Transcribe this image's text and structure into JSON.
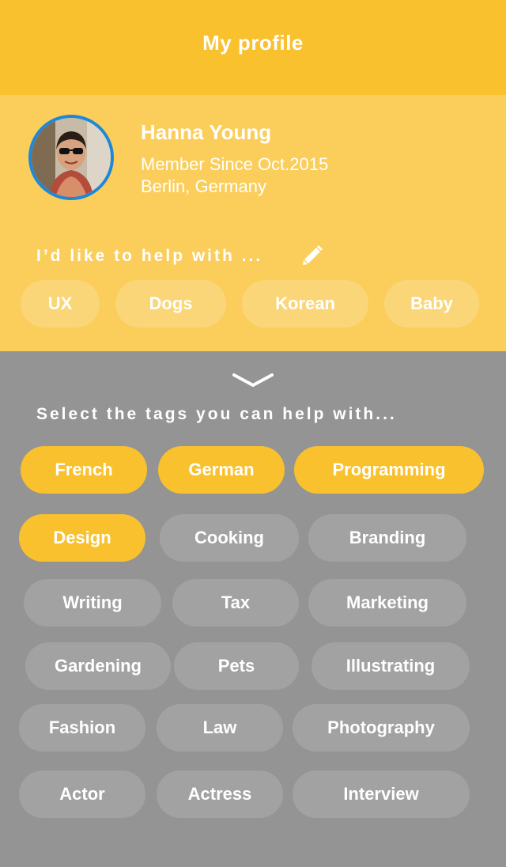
{
  "header": {
    "title": "My profile"
  },
  "profile": {
    "name": "Hanna Young",
    "member_since": "Member Since Oct.2015",
    "location": "Berlin, Germany",
    "help_label": "I’d like to help with ...",
    "my_tags": [
      "UX",
      "Dogs",
      "Korean",
      "Baby"
    ]
  },
  "select": {
    "label": "Select the tags you can help with...",
    "tags": [
      {
        "label": "French",
        "selected": true
      },
      {
        "label": "German",
        "selected": true
      },
      {
        "label": "Programming",
        "selected": true
      },
      {
        "label": "Design",
        "selected": true
      },
      {
        "label": "Cooking",
        "selected": false
      },
      {
        "label": "Branding",
        "selected": false
      },
      {
        "label": "Writing",
        "selected": false
      },
      {
        "label": "Tax",
        "selected": false
      },
      {
        "label": "Marketing",
        "selected": false
      },
      {
        "label": "Gardening",
        "selected": false
      },
      {
        "label": "Pets",
        "selected": false
      },
      {
        "label": "Illustrating",
        "selected": false
      },
      {
        "label": "Fashion",
        "selected": false
      },
      {
        "label": "Law",
        "selected": false
      },
      {
        "label": "Photography",
        "selected": false
      },
      {
        "label": "Actor",
        "selected": false
      },
      {
        "label": "Actress",
        "selected": false
      },
      {
        "label": "Interview",
        "selected": false
      }
    ]
  },
  "colors": {
    "header": "#F9C12E",
    "profile_bg": "#FBCE5B",
    "panel_bg": "#949494",
    "tag_selected": "#F9C12E",
    "tag_unselected": "#A2A2A2",
    "avatar_ring": "#1E88D8"
  },
  "icons": {
    "edit": "pencil-icon",
    "collapse": "chevron-down-icon"
  }
}
